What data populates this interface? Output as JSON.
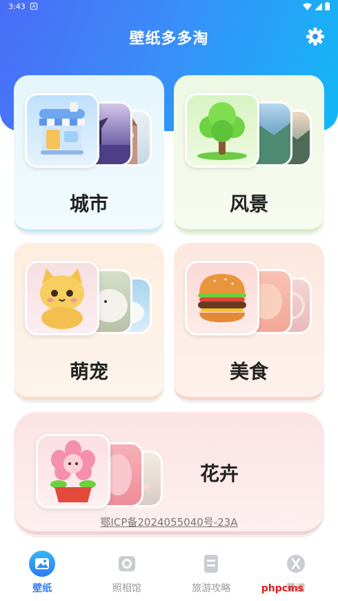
{
  "status": {
    "time": "3:43",
    "badge": "A"
  },
  "header": {
    "title": "壁纸多多淘"
  },
  "categories": {
    "city": "城市",
    "scenery": "风景",
    "pet": "萌宠",
    "food": "美食",
    "flower": "花卉"
  },
  "footer": {
    "icp": "鄂ICP备2024055040号-23A"
  },
  "tabs": [
    {
      "label": "壁纸"
    },
    {
      "label": "照相馆"
    },
    {
      "label": "旅游攻略"
    },
    {
      "label": "菜谱"
    }
  ],
  "watermark": "phpcms",
  "colors": {
    "accent": "#2f7cf6",
    "header_start": "#4a6cf7",
    "header_end": "#12b8f6"
  }
}
